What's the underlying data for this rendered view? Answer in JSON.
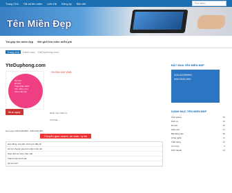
{
  "topnav": {
    "items": [
      "Trang Chủ",
      "Tất cả tên miền",
      "Liên Hệ",
      "Đăng ký",
      "Bài viết"
    ],
    "search_placeholder": "Tìm kiếm"
  },
  "banner": {
    "title": "Tên Miền Đẹp"
  },
  "subnav": {
    "items": [
      "Trả góp tên miền đẹp",
      "Mở giới tên miền miễn phí"
    ]
  },
  "breadcrumb": {
    "home": "Trang chủ",
    "cat": "Danh mục",
    "current": "YteDuphong.com"
  },
  "product": {
    "domain": "YteDuphong.com",
    "price": "25.000.000 VNĐ",
    "badge_lines": [
      "Dễ nhớ",
      "Dễ đọc",
      "Thân thiện SEO",
      "Tên miền .com",
      "Giá trị lâu dài"
    ],
    "buy": "Mua ngay",
    "category": "Danh mục: Dịch vụ",
    "tags": "Từ khóa: ..."
  },
  "contact": {
    "line": "Gọi ngay: 028.22259999 - 098.2345.999",
    "tab": "Chuyển giao nhanh, an toàn, uy tín"
  },
  "rows": [
    "Hợp đồng, hóa đơn chứng từ đầy đủ",
    "Hỗ trợ chuyển giao tên miền miễn phí",
    "Giao dịch an toàn, bảo mật",
    "Thanh toán linh hoạt",
    "Hỗ trợ 24/7"
  ],
  "sidebar": {
    "head1": "ĐẶT MUA TÊN MIỀN ĐẸP",
    "hotline": [
      "028.22259999",
      "098.2345.999"
    ],
    "head2": "DANH MỤC TÊN MIỀN ĐẸP",
    "cats": [
      {
        "n": "Cáp quang",
        "c": "20"
      },
      {
        "n": "Dịch vụ",
        "c": "36"
      },
      {
        "n": "Du lịch",
        "c": "18"
      },
      {
        "n": "Giáo dục",
        "c": "21"
      },
      {
        "n": "Bất động sản",
        "c": "30"
      },
      {
        "n": "Công nghệ",
        "c": "14"
      },
      {
        "n": "Thời trang",
        "c": "12"
      },
      {
        "n": "Ẩm thực",
        "c": "9"
      },
      {
        "n": "Kinh doanh",
        "c": "25"
      }
    ]
  }
}
